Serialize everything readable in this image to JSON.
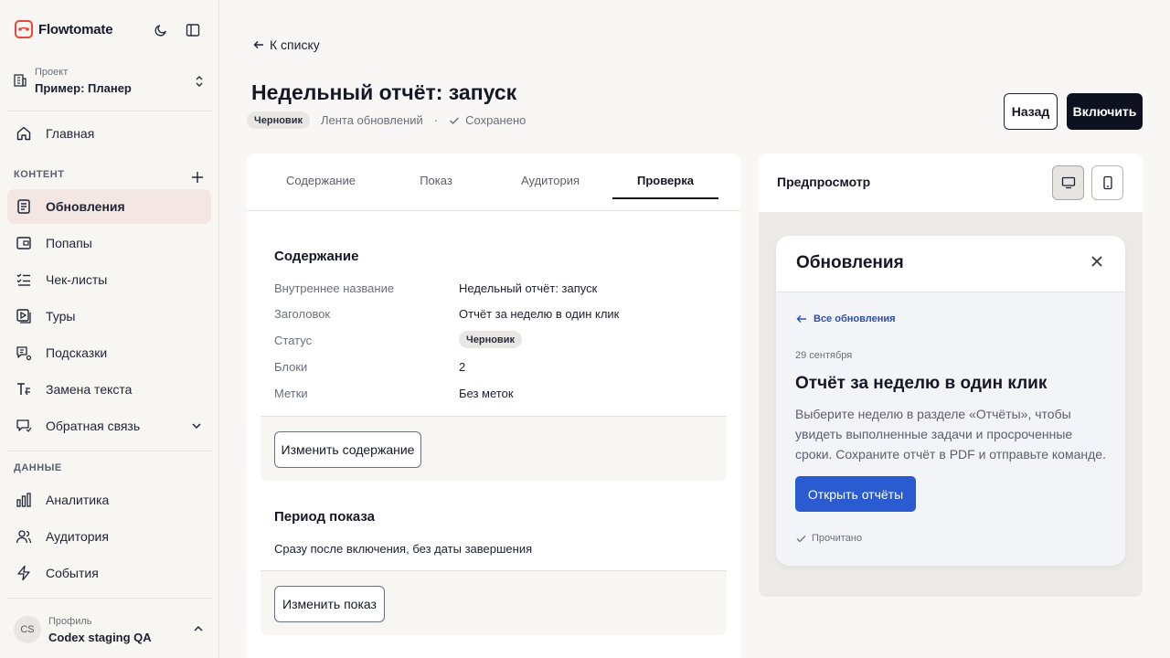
{
  "app": {
    "name": "Flowtomate",
    "brand_color": "#e6473b"
  },
  "project": {
    "label": "Проект",
    "value": "Пример: Планер"
  },
  "nav": {
    "main": {
      "label": "Главная",
      "icon": "home-icon"
    },
    "content_section": "КОНТЕНТ",
    "content_items": [
      {
        "label": "Обновления",
        "icon": "updates-icon",
        "active": true
      },
      {
        "label": "Попапы",
        "icon": "popup-icon"
      },
      {
        "label": "Чек-листы",
        "icon": "checklist-icon"
      },
      {
        "label": "Туры",
        "icon": "tour-icon"
      },
      {
        "label": "Подсказки",
        "icon": "hint-icon"
      },
      {
        "label": "Замена текста",
        "icon": "text-replace-icon"
      },
      {
        "label": "Обратная связь",
        "icon": "feedback-icon"
      }
    ],
    "data_section": "ДАННЫЕ",
    "data_items": [
      {
        "label": "Аналитика",
        "icon": "analytics-icon"
      },
      {
        "label": "Аудитория",
        "icon": "audience-icon"
      },
      {
        "label": "События",
        "icon": "events-icon"
      }
    ]
  },
  "profile": {
    "initials": "CS",
    "label": "Профиль",
    "value": "Codex staging QA"
  },
  "header": {
    "back": "К списку",
    "title": "Недельный отчёт: запуск",
    "status_badge": "Черновик",
    "type": "Лента обновлений",
    "dot": "·",
    "saved": "Сохранено",
    "back_button": "Назад",
    "enable_button": "Включить"
  },
  "tabs": [
    "Содержание",
    "Показ",
    "Аудитория",
    "Проверка"
  ],
  "active_tab": "Проверка",
  "content_section": {
    "title": "Содержание",
    "rows": [
      {
        "label": "Внутреннее название",
        "value": "Недельный отчёт: запуск"
      },
      {
        "label": "Заголовок",
        "value": "Отчёт за неделю в один клик"
      },
      {
        "label": "Статус",
        "value": "Черновик"
      },
      {
        "label": "Блоки",
        "value": "2"
      },
      {
        "label": "Метки",
        "value": "Без меток"
      }
    ],
    "edit_button": "Изменить содержание"
  },
  "period_section": {
    "title": "Период показа",
    "text": "Сразу после включения, без даты завершения",
    "edit_button": "Изменить показ"
  },
  "preview": {
    "title": "Предпросмотр",
    "widget": {
      "title": "Обновления",
      "back": "Все обновления",
      "date": "29 сентября",
      "heading": "Отчёт за неделю в один клик",
      "body": "Выберите неделю в разделе «Отчёты», чтобы увидеть выполненные задачи и просроченные сроки. Сохраните отчёт в PDF и отправьте команде.",
      "cta": "Открыть отчёты",
      "read": "Прочитано",
      "accent": "#2a5bd0"
    }
  }
}
